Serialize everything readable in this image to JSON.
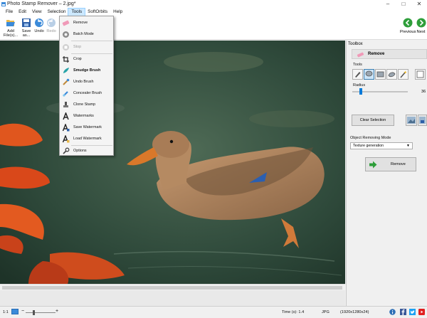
{
  "window": {
    "title": "Photo Stamp Remover – 2.jpg*",
    "controls": [
      "minimize",
      "maximize",
      "close"
    ]
  },
  "menubar": {
    "items": [
      "File",
      "Edit",
      "View",
      "Selection",
      "Tools",
      "SoftOrbits",
      "Help"
    ],
    "active": "Tools"
  },
  "toolbar": {
    "add_files": "Add File(s)...",
    "save_as": "Save as...",
    "undo": "Undo",
    "redo": "Redo",
    "previous": "Previous",
    "next": "Next"
  },
  "tools_menu": {
    "items": [
      {
        "label": "Remove",
        "icon": "eraser-icon",
        "enabled": true
      },
      {
        "label": "Batch Mode",
        "icon": "gear-icon",
        "enabled": true
      },
      {
        "label": "Stop",
        "icon": "stop-icon",
        "enabled": false
      },
      {
        "label": "Crop",
        "icon": "crop-icon",
        "enabled": true
      },
      {
        "label": "Smudge Brush",
        "icon": "smudge-brush-icon",
        "enabled": true
      },
      {
        "label": "Undo Brush",
        "icon": "undo-brush-icon",
        "enabled": true
      },
      {
        "label": "Concealer Brush",
        "icon": "concealer-brush-icon",
        "enabled": true
      },
      {
        "label": "Clone Stamp",
        "icon": "clone-stamp-icon",
        "enabled": true
      },
      {
        "label": "Watermarks",
        "icon": "watermark-icon",
        "enabled": true
      },
      {
        "label": "Save Watermark",
        "icon": "save-watermark-icon",
        "enabled": true
      },
      {
        "label": "Load Watermark",
        "icon": "load-watermark-icon",
        "enabled": true
      },
      {
        "label": "Options",
        "icon": "wrench-icon",
        "enabled": true
      }
    ]
  },
  "toolbox": {
    "title": "Toolbox",
    "section": "Remove",
    "tools_label": "Tools",
    "tools": [
      "pencil-icon",
      "lasso-icon",
      "rect-select-icon",
      "marker-icon",
      "magic-wand-icon",
      "close-selection-icon"
    ],
    "selected_tool": "lasso-icon",
    "radius_label": "Radius",
    "radius_value": "36",
    "radius_fraction": 0.15,
    "clear_selection": "Clear Selection",
    "mode_label": "Object Removing Mode",
    "mode_value": "Texture generation",
    "remove_button": "Remove"
  },
  "statusbar": {
    "zoom": "1:1",
    "time": "Time (s): 1.4",
    "format": "JPG",
    "dimensions": "(1920x1280x24)"
  },
  "colors": {
    "accent_blue": "#007ad9",
    "nav_green": "#2e9e3a",
    "menu_highlight": "#cce8ff"
  }
}
